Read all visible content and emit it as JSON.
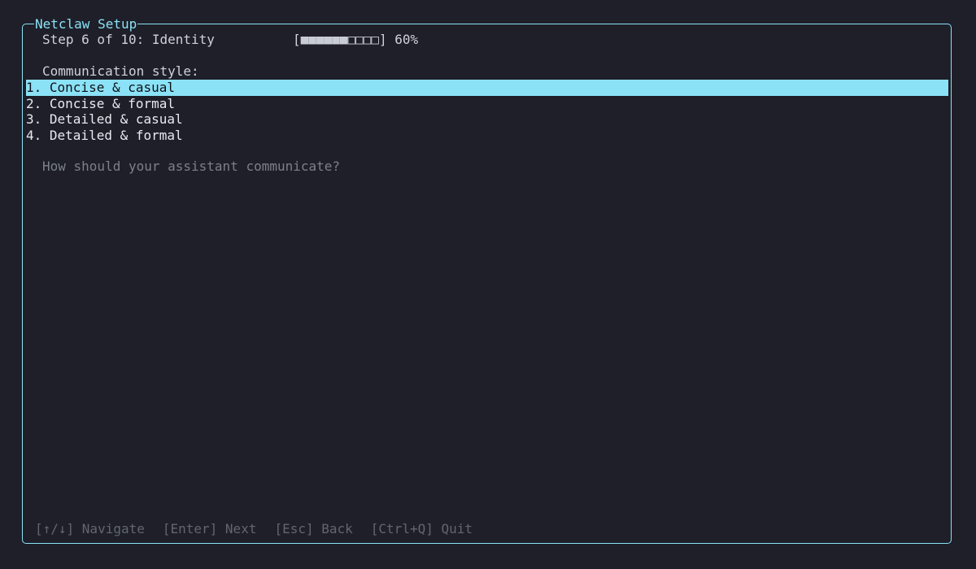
{
  "window": {
    "title": "Netclaw Setup"
  },
  "header": {
    "step_text": "Step 6 of 10: Identity",
    "progress_filled": "■■■■■■",
    "progress_empty": "□□□□",
    "progress_percent": "60%",
    "progress_value": 0.6
  },
  "question": {
    "label": "Communication style:",
    "help": "How should your assistant communicate?"
  },
  "options": [
    {
      "text": "1. Concise & casual",
      "selected": true
    },
    {
      "text": "2. Concise & formal",
      "selected": false
    },
    {
      "text": "3. Detailed & casual",
      "selected": false
    },
    {
      "text": "4. Detailed & formal",
      "selected": false
    }
  ],
  "footer": {
    "navigate": "[↑/↓] Navigate",
    "next": "[Enter] Next",
    "back": "[Esc] Back",
    "quit": "[Ctrl+Q] Quit"
  },
  "colors": {
    "background": "#1e1f29",
    "accent": "#8be2f6",
    "text": "#cfd2da",
    "muted": "#7c808a"
  }
}
